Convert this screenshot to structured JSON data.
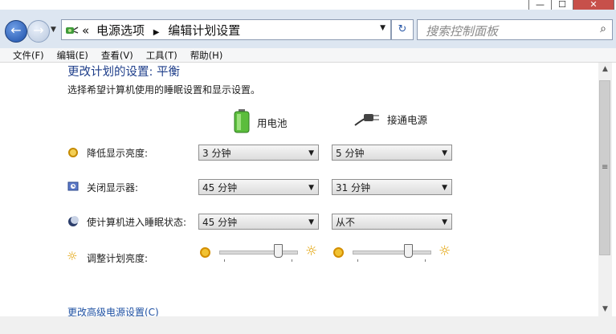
{
  "window": {
    "minimize": "—",
    "maximize": "☐",
    "close": "✕"
  },
  "nav": {
    "back": "←",
    "forward": "→",
    "breadcrumb_prefix": "«",
    "breadcrumb": [
      "电源选项",
      "编辑计划设置"
    ],
    "search_placeholder": "搜索控制面板",
    "refresh": "↻",
    "search_icon": "⌕"
  },
  "menu": [
    "文件(F)",
    "编辑(E)",
    "查看(V)",
    "工具(T)",
    "帮助(H)"
  ],
  "page": {
    "title": "更改计划的设置: 平衡",
    "subtitle": "选择希望计算机使用的睡眠设置和显示设置。",
    "col_battery": "用电池",
    "col_plugged": "接通电源",
    "link_advanced": "更改高级电源设置(C)"
  },
  "rows": [
    {
      "label": "降低显示亮度:",
      "battery": "3 分钟",
      "plugged": "5 分钟",
      "icon": "dim-display-icon"
    },
    {
      "label": "关闭显示器:",
      "battery": "45 分钟",
      "plugged": "31 分钟",
      "icon": "display-off-icon"
    },
    {
      "label": "使计算机进入睡眠状态:",
      "battery": "45 分钟",
      "plugged": "从不",
      "icon": "sleep-icon"
    }
  ],
  "brightness": {
    "label": "调整计划亮度:",
    "battery_level": 0.78,
    "plugged_level": 0.74
  },
  "colors": {
    "accent": "#1e3e8a",
    "link": "#1e50a2",
    "close": "#c7504a"
  }
}
